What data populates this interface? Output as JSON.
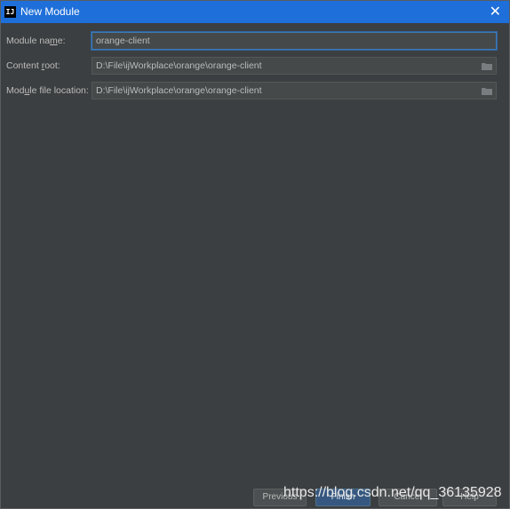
{
  "window": {
    "title": "New Module",
    "close_glyph": "✕",
    "app_icon_text": "IJ"
  },
  "form": {
    "module_name": {
      "label_pre": "Module na",
      "label_mn": "m",
      "label_post": "e:",
      "value": "orange-client"
    },
    "content_root": {
      "label_pre": "Content ",
      "label_mn": "r",
      "label_post": "oot:",
      "value": "D:\\File\\ijWorkplace\\orange\\orange-client"
    },
    "module_file_location": {
      "label_pre": "Mod",
      "label_mn": "u",
      "label_post": "le file location:",
      "value": "D:\\File\\ijWorkplace\\orange\\orange-client"
    }
  },
  "buttons": {
    "previous": "Previous",
    "finish": "Finish",
    "cancel": "Cancel",
    "help": "Help"
  },
  "watermark": "https://blog.csdn.net/qq_36135928",
  "colors": {
    "titlebar": "#1e6fd9",
    "background": "#3c3f41",
    "field": "#45494a",
    "focus": "#3d7ab6"
  },
  "icons": {
    "folder": "folder-icon",
    "close": "close-icon",
    "app": "intellij-icon"
  }
}
